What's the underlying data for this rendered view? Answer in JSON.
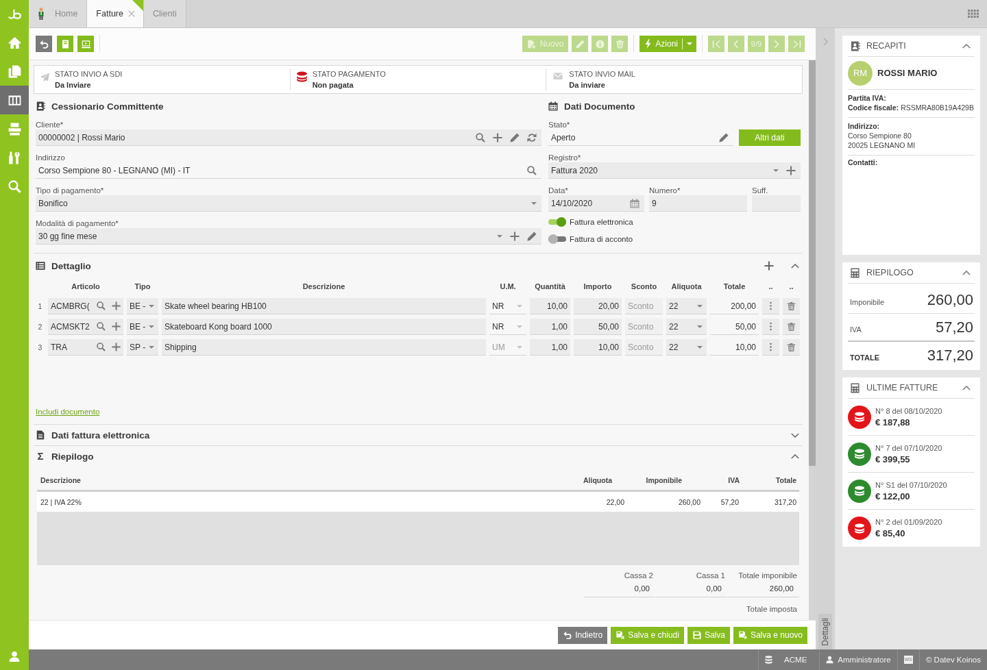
{
  "sidebar": {
    "items": [
      {
        "selected": false
      },
      {
        "selected": false
      },
      {
        "selected": true
      },
      {
        "selected": false
      },
      {
        "selected": false
      },
      {
        "selected": false
      }
    ]
  },
  "tabs": [
    {
      "label": "Home",
      "selected": false,
      "closable": false
    },
    {
      "label": "Fatture",
      "selected": true,
      "closable": true
    },
    {
      "label": "Clienti",
      "selected": false,
      "closable": false
    }
  ],
  "toolbar": {
    "edit_buttons": [
      {
        "kind": "new",
        "label": "Nuovo",
        "disabled": true
      },
      {
        "kind": "edit",
        "disabled": true
      },
      {
        "kind": "info",
        "disabled": true
      },
      {
        "kind": "delete",
        "disabled": true
      }
    ],
    "actions_button": {
      "label": "Azioni",
      "disabled": false
    },
    "pager": {
      "position": "9/9",
      "disabled": true
    }
  },
  "status_panel": [
    {
      "kind": "sdi",
      "title": "STATO INVIO A SDI",
      "value": "Da Inviare"
    },
    {
      "kind": "payment",
      "title": "STATO PAGAMENTO",
      "value": "Non pagata"
    },
    {
      "kind": "mail",
      "title": "STATO INVIO MAIL",
      "value": "Da inviare"
    }
  ],
  "customer_section": {
    "title": "Cessionario Committente",
    "fields": [
      {
        "kind": "lookup",
        "label": "Cliente*",
        "value": "00000002 | Rossi Mario"
      },
      {
        "kind": "readonly",
        "label": "Indirizzo",
        "value": "Corso Sempione 80 - LEGNANO (MI) - IT"
      },
      {
        "kind": "select",
        "label": "Tipo di pagamento*",
        "value": "Bonifico"
      },
      {
        "kind": "select_edit",
        "label": "Modalità di pagamento*",
        "value": "30 gg fine mese"
      }
    ]
  },
  "document_section": {
    "title": "Dati Documento",
    "state_field": {
      "label": "Stato*",
      "value": "Aperto"
    },
    "more_button": "Altri dati",
    "register_field": {
      "label": "Registro*",
      "value": "Fattura 2020"
    },
    "date_field": {
      "label": "Data*",
      "value": "14/10/2020"
    },
    "number_field": {
      "label": "Numero*",
      "value": "9"
    },
    "suffix_field": {
      "label": "Suff."
    },
    "toggles": [
      {
        "label": "Fattura elettronica",
        "on": true
      },
      {
        "label": "Fattura di acconto",
        "on": false
      }
    ]
  },
  "detail_section": {
    "title": "Dettaglio",
    "expanded": true,
    "columns": [
      "Articolo",
      "Tipo",
      "Descrizione",
      "U.M.",
      "Quantità",
      "Importo",
      "Sconto",
      "Aliquota",
      "Totale",
      "..",
      ".."
    ],
    "rows": [
      {
        "number": "1",
        "article": "ACMBRG(",
        "type": "BE -",
        "description": "Skate wheel bearing HB100",
        "unit": {
          "value": "NR"
        },
        "quantity": "10,00",
        "amount": "20,00",
        "discount": {
          "placeholder": "Sconto"
        },
        "vat": "22",
        "total": "200,00"
      },
      {
        "number": "2",
        "article": "ACMSKT2",
        "type": "BE -",
        "description": "Skateboard Kong board 1000",
        "unit": {
          "value": "NR"
        },
        "quantity": "1,00",
        "amount": "50,00",
        "discount": {
          "placeholder": "Sconto"
        },
        "vat": "22",
        "total": "50,00"
      },
      {
        "number": "3",
        "article": "TRA",
        "type": "SP -",
        "description": "Shipping",
        "unit": {
          "placeholder": "UM"
        },
        "quantity": "1,00",
        "amount": "10,00",
        "discount": {
          "placeholder": "Sconto"
        },
        "vat": "22",
        "total": "10,00"
      }
    ],
    "include_link": "Includi documento"
  },
  "e_invoice_section": {
    "title": "Dati fattura elettronica",
    "expanded": false
  },
  "summary_section": {
    "icon": "Σ",
    "title": "Riepilogo",
    "expanded": true,
    "columns": [
      "Descrizione",
      "Aliquota",
      "Imponibile",
      "IVA",
      "Totale"
    ],
    "rows": [
      [
        "22 | IVA 22%",
        "22,00",
        "260,00",
        "57,20",
        "317,20"
      ]
    ],
    "totals": [
      {
        "label": "Cassa 2",
        "value": "0,00"
      },
      {
        "label": "Cassa 1",
        "value": "0,00"
      },
      {
        "label": "Totale imponibile",
        "value": "260,00"
      }
    ],
    "tax_total_label": "Totale imposta"
  },
  "footer_buttons": [
    {
      "kind": "back",
      "label": "Indietro"
    },
    {
      "kind": "save_close",
      "label": "Salva e chiudi"
    },
    {
      "kind": "save",
      "label": "Salva"
    },
    {
      "kind": "save_new",
      "label": "Salva e nuovo"
    }
  ],
  "details_tab": {
    "label": "Dettagli"
  },
  "contact_card": {
    "title": "RECAPITI",
    "expanded": true,
    "initials": "RM",
    "name": "ROSSI MARIO",
    "tax_lines": [
      {
        "label": "Partita IVA:"
      },
      {
        "label": "Codice fiscale:",
        "value": "RSSMRA80B19A429B"
      }
    ],
    "address_label": "Indirizzo:",
    "address_lines": [
      "Corso Sempione 80",
      "20025 LEGNANO MI"
    ],
    "contacts_label": "Contatti:"
  },
  "summary_card": {
    "title": "RIEPILOGO",
    "expanded": true,
    "rows": [
      {
        "kind": "line",
        "label": "Imponibile",
        "value": "260,00"
      },
      {
        "kind": "line",
        "label": "IVA",
        "value": "57,20"
      },
      {
        "kind": "total",
        "label": "TOTALE",
        "value": "317,20"
      }
    ]
  },
  "recent_invoices": {
    "title": "ULTIME FATTURE",
    "expanded": true,
    "items": [
      {
        "title": "N° 8 del 08/10/2020",
        "amount": "€ 187,88",
        "color": "#e3151a"
      },
      {
        "title": "N° 7 del 07/10/2020",
        "amount": "€ 399,55",
        "color": "#2e8a2e"
      },
      {
        "title": "N° S1 del 07/10/2020",
        "amount": "€ 122,00",
        "color": "#2e8a2e"
      },
      {
        "title": "N° 2 del 01/09/2020",
        "amount": "€ 85,40",
        "color": "#e3151a"
      }
    ]
  },
  "status_bar": [
    {
      "kind": "database",
      "label": "ACME"
    },
    {
      "kind": "user",
      "label": "Amministratore"
    },
    {
      "kind": "badge",
      "label": "WS"
    },
    {
      "kind": "text",
      "label": "© Datev Koinos"
    }
  ]
}
